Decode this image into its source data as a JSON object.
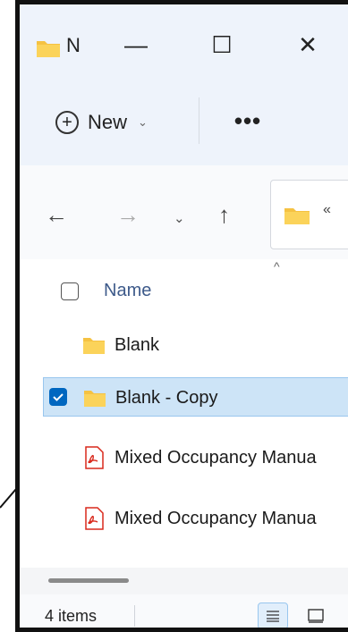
{
  "window": {
    "title": "N"
  },
  "titlebar": {
    "min": "—",
    "max": "☐",
    "close": "✕"
  },
  "toolbar": {
    "new_label": "New",
    "new_icon": "plus-circle-icon",
    "more_label": "•••"
  },
  "nav": {
    "back": "←",
    "forward": "→",
    "recent": "⌄",
    "up": "↑",
    "address_overflow": "«"
  },
  "columns": {
    "name": "Name",
    "sort_indicator": "^"
  },
  "files": [
    {
      "name": "Blank",
      "type": "folder"
    },
    {
      "name": "Blank - Copy",
      "type": "folder",
      "selected": true
    },
    {
      "name": "Mixed Occupancy Manua",
      "type": "pdf"
    },
    {
      "name": "Mixed Occupancy Manua",
      "type": "pdf"
    }
  ],
  "status": {
    "item_count": "4 items"
  },
  "colors": {
    "folder": "#f5c242",
    "selection": "#cde4f7",
    "accent": "#0067c0",
    "pdf": "#d9291c"
  }
}
